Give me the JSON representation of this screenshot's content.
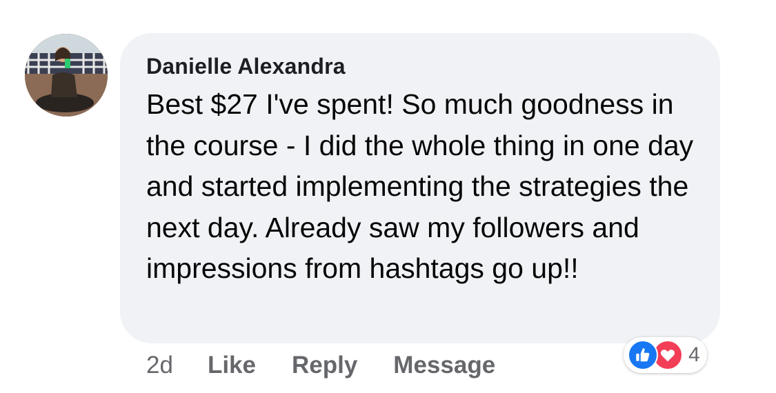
{
  "comment": {
    "author": "Danielle Alexandra",
    "text": "Best $27 I've spent! So much goodness in the course - I did the whole thing in one day and started implementing the strategies the next day. Already saw my followers and impressions from hashtags go up!!",
    "time": "2d",
    "actions": {
      "like": "Like",
      "reply": "Reply",
      "message": "Message"
    },
    "reactions": {
      "count": "4",
      "icons": [
        "like-icon",
        "love-icon"
      ]
    }
  },
  "colors": {
    "bubble": "#f0f2f5",
    "meta_text": "#65676b",
    "like_blue": "#1877f2",
    "love_red": "#f33e58"
  }
}
